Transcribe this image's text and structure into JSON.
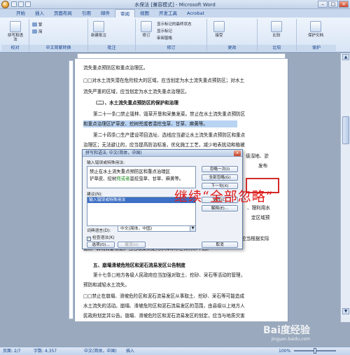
{
  "window": {
    "title": "水保法 [兼容模式] - Microsoft Word"
  },
  "tabs": [
    "开始",
    "插入",
    "页面布局",
    "引用",
    "邮件",
    "审阅",
    "视图",
    "开发工具",
    "Acrobat"
  ],
  "active_tab": "审阅",
  "ribbon": {
    "groups": [
      "校对",
      "中文简繁转换",
      "批注",
      "修订",
      "更改",
      "比较",
      "保护"
    ],
    "proofing_btn": "拼写和语法",
    "new_comment": "新建批注",
    "track_btn": "修订",
    "markup_dd": "显示标记的最终状态",
    "show_markup": "显示标记",
    "review_pane": "审阅窗格",
    "accept": "接受",
    "compare": "比较",
    "protect": "保护文档"
  },
  "document": {
    "lines": [
      "流失重点预防区和重点治理区。",
      "□□对水土流失潜在危险较大的区域，应当划定为水土流失重点预防区；对水土",
      "流失严重的区域，应当划定为水土流失重点治理区。",
      "（二）、水土流失重点预防区的保护和治理",
      "第二十一条□禁止毁林、毁草开垦和采集发菜。禁止在水土流失重点预防区",
      "和重点治理区铲草皮、挖树兜或者滥挖虫草、甘草、麻黄等。",
      "第二十四条□生产建设项目选址、选线应当避让水土流失重点预防区和重点",
      "治理区；无法避让的，应当提高防治标准，优化施工工艺，减少地表扰动和植被",
      "损坏",
      "分",
      "的措",
      "施，",
      "崩塌",
      "方法",
      "监测",
      "五、崩塌滑坡危险区和泥石流易发区公告制度",
      "第十七条□地方各级人民政府应当加强对取土、挖砂、采石等活动的管理，",
      "预防和减轻水土流失。",
      "□□禁止在崩塌、滑坡危险区和泥石流易发区从事取土、挖砂、采石等可能造成",
      "水土流失的活动。崩塌、滑坡危险区和泥石流易发区的范围，由县级以上地方人",
      "民政府划定并公告。崩塌、滑坡危险区和泥石流易发区的划定，应当与地质灾害",
      "防治规划确定的地质灾害易发区、重点防治区相衔接。",
      "六、地貌植被保护制度"
    ],
    "right_fragments": [
      "级湿地、淤",
      "发布",
      "、理利用水",
      "定区域预",
      "应当根据实际"
    ],
    "lower_fragment": "情况需要根据，当当收集测定用水挥冰水土保持水平后。"
  },
  "dialog": {
    "title": "拼写和语法: 中文(简体，中国)",
    "input_label": "输入错误或特殊用法:",
    "sentence_part1": "禁止在水土流失重点预防区和重点治理区",
    "sentence_part2": "铲草皮、挖树",
    "sentence_err": "兜或者",
    "sentence_part3": "滥挖虫草、甘草、麻黄等。",
    "suggest_label": "建议(N):",
    "suggestion": "输入错误或特殊用法",
    "lang_label": "词典语言(D):",
    "lang_value": "中文(简体，中国)",
    "check_grammar": "检查语法(K)",
    "buttons": {
      "ignore_once": "忽略一次(I)",
      "ignore_all": "全部忽略(G)",
      "next_sentence": "下一句(X)",
      "change": "更改(C)",
      "explain": "解释(E)...",
      "options": "选项(O)...",
      "undo": "撤消(U)",
      "cancel": "取消"
    },
    "close_icon": "×"
  },
  "annotation": "继续“全部忽略”",
  "status": {
    "page": "页面: 2/7",
    "words": "字数: 4,357",
    "lang": "中文(简体，中国)",
    "mode": "插入",
    "zoom": "100%"
  },
  "watermark": {
    "brand": "Bai度经验",
    "url": "jingyan.baidu.com"
  },
  "colors": {
    "accent": "#15428b",
    "annotation": "#e21818",
    "highlight": "#b9d3f2"
  }
}
